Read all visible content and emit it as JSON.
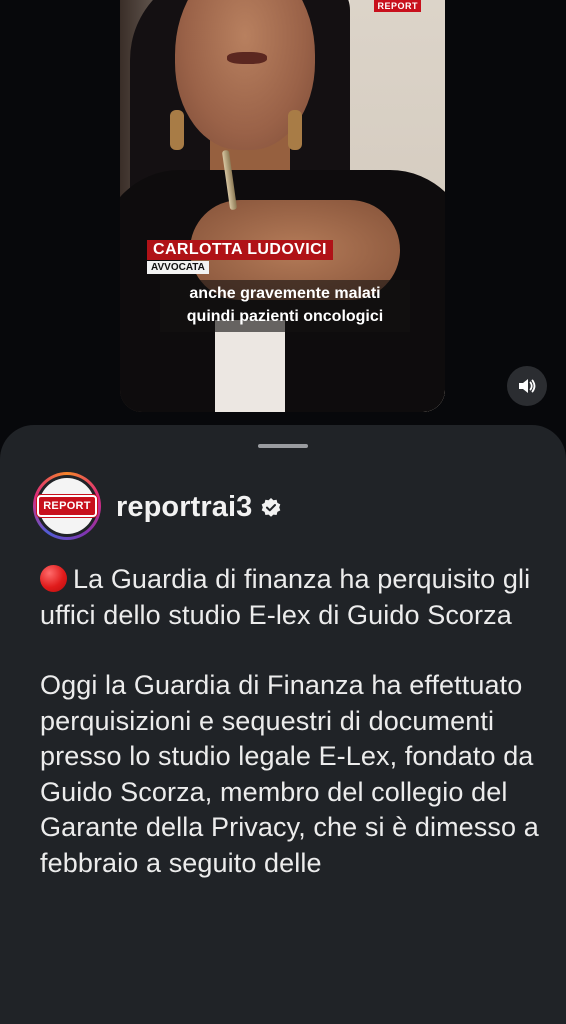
{
  "video": {
    "logo_text": "REPORT",
    "name_tag": "CARLOTTA LUDOVICI",
    "role_tag": "AVVOCATA",
    "caption_lines": [
      "anche gravemente malati",
      "quindi pazienti oncologici"
    ],
    "mute_icon": "speaker-volume-icon"
  },
  "post": {
    "avatar_logo": "REPORT",
    "username": "reportrai3",
    "verified_icon": "verified-badge-icon",
    "headline_emoji": "red-circle-icon",
    "headline": "La Guardia di finanza ha perquisito gli uffici dello studio E-lex di Guido Scorza",
    "body": "Oggi la Guardia di Finanza ha effettuato perquisizioni e sequestri di documenti presso lo studio legale E-Lex, fondato da Guido Scorza, membro del collegio del Garante della Privacy, che si è dimesso a febbraio a seguito delle"
  },
  "colors": {
    "sheet_bg": "#202327",
    "accent_red": "#c8101c",
    "text": "#ececec"
  }
}
